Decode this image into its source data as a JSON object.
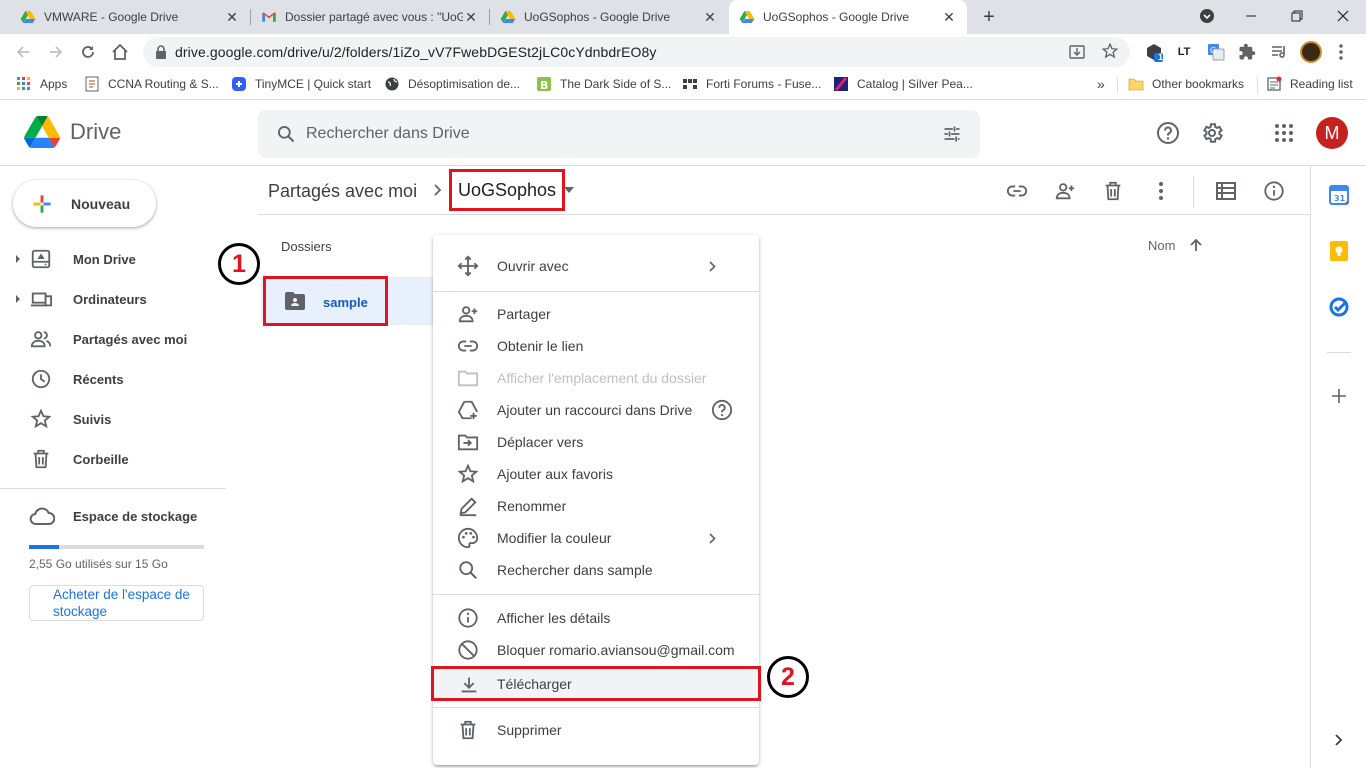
{
  "browser": {
    "tabs": [
      {
        "title": "VMWARE - Google Drive",
        "favicon": "drive-icon"
      },
      {
        "title": "Dossier partagé avec vous : \"UoG",
        "favicon": "gmail-icon"
      },
      {
        "title": "UoGSophos - Google Drive",
        "favicon": "drive-icon"
      },
      {
        "title": "UoGSophos - Google Drive",
        "favicon": "drive-icon",
        "active": true
      }
    ],
    "url": "drive.google.com/drive/u/2/folders/1iZo_vV7FwebDGESt2jLC0cYdnbdrEO8y",
    "extension_badge": "1",
    "bookmarks": [
      {
        "label": "Apps"
      },
      {
        "label": "CCNA Routing & S..."
      },
      {
        "label": "TinyMCE | Quick start"
      },
      {
        "label": "Désoptimisation de..."
      },
      {
        "label": "The Dark Side of S..."
      },
      {
        "label": "Forti Forums - Fuse..."
      },
      {
        "label": "Catalog | Silver Pea..."
      }
    ],
    "bookmarks_overflow": "»",
    "other_bookmarks": "Other bookmarks",
    "reading_list": "Reading list"
  },
  "drive": {
    "logo_text": "Drive",
    "search_placeholder": "Rechercher dans Drive",
    "avatar_letter": "M",
    "new_button": "Nouveau",
    "nav": [
      {
        "label": "Mon Drive",
        "icon": "my-drive-icon",
        "expandable": true
      },
      {
        "label": "Ordinateurs",
        "icon": "computers-icon",
        "expandable": true
      },
      {
        "label": "Partagés avec moi",
        "icon": "shared-icon"
      },
      {
        "label": "Récents",
        "icon": "clock-icon"
      },
      {
        "label": "Suivis",
        "icon": "star-icon"
      },
      {
        "label": "Corbeille",
        "icon": "trash-icon"
      }
    ],
    "storage": {
      "title": "Espace de stockage",
      "used_fraction": 0.17,
      "usage_text": "2,55 Go utilisés sur 15 Go",
      "buy_button": "Acheter de l'espace de stockage"
    },
    "breadcrumb": {
      "parent": "Partagés avec moi",
      "current": "UoGSophos"
    },
    "folders_header": "Dossiers",
    "sort_label": "Nom",
    "folder": {
      "name": "sample"
    },
    "callouts": [
      "1",
      "2"
    ],
    "accent_color": "#1a73e8",
    "highlight_color": "#e0131e"
  },
  "context_menu": {
    "items": [
      {
        "label": "Ouvrir avec",
        "icon": "move-arrows-icon",
        "submenu": true
      },
      {
        "label": "Partager",
        "icon": "add-person-icon"
      },
      {
        "label": "Obtenir le lien",
        "icon": "link-icon"
      },
      {
        "label": "Afficher l'emplacement du dossier",
        "icon": "folder-icon",
        "disabled": true
      },
      {
        "label": "Ajouter un raccourci dans Drive",
        "icon": "add-shortcut-icon",
        "help": true
      },
      {
        "label": "Déplacer vers",
        "icon": "move-to-icon"
      },
      {
        "label": "Ajouter aux favoris",
        "icon": "star-icon"
      },
      {
        "label": "Renommer",
        "icon": "pencil-icon"
      },
      {
        "label": "Modifier la couleur",
        "icon": "palette-icon",
        "submenu": true
      },
      {
        "label": "Rechercher dans sample",
        "icon": "search-icon"
      },
      {
        "label": "Afficher les détails",
        "icon": "info-icon"
      },
      {
        "label": "Bloquer romario.aviansou@gmail.com",
        "icon": "block-icon"
      },
      {
        "label": "Télécharger",
        "icon": "download-icon",
        "highlighted": true
      },
      {
        "label": "Supprimer",
        "icon": "trash-icon"
      }
    ]
  }
}
